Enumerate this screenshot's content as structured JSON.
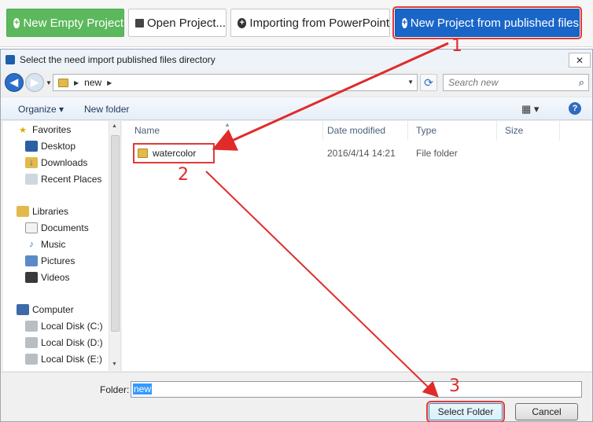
{
  "toolbar": {
    "new_empty": "New Empty Project",
    "open": "Open Project...",
    "import_ppt": "Importing from PowerPoint",
    "new_published": "New Project from published files"
  },
  "dialog": {
    "title": "Select the need import published files directory",
    "breadcrumb": "new",
    "search_placeholder": "Search new",
    "organize": "Organize",
    "new_folder": "New folder",
    "nav": {
      "favorites": "Favorites",
      "desktop": "Desktop",
      "downloads": "Downloads",
      "recent": "Recent Places",
      "libraries": "Libraries",
      "documents": "Documents",
      "music": "Music",
      "pictures": "Pictures",
      "videos": "Videos",
      "computer": "Computer",
      "disk_c": "Local Disk (C:)",
      "disk_d": "Local Disk (D:)",
      "disk_e": "Local Disk (E:)"
    },
    "columns": [
      "Name",
      "Date modified",
      "Type",
      "Size"
    ],
    "files": [
      {
        "name": "watercolor",
        "date": "2016/4/14 14:21",
        "type": "File folder",
        "size": ""
      }
    ],
    "folder_label": "Folder:",
    "folder_value": "new",
    "select_button": "Select Folder",
    "cancel_button": "Cancel"
  },
  "annotations": [
    "1",
    "2",
    "3"
  ],
  "colors": {
    "annotation": "#e02b2b",
    "green_button": "#5cb85c",
    "blue_button": "#1a66c8"
  }
}
